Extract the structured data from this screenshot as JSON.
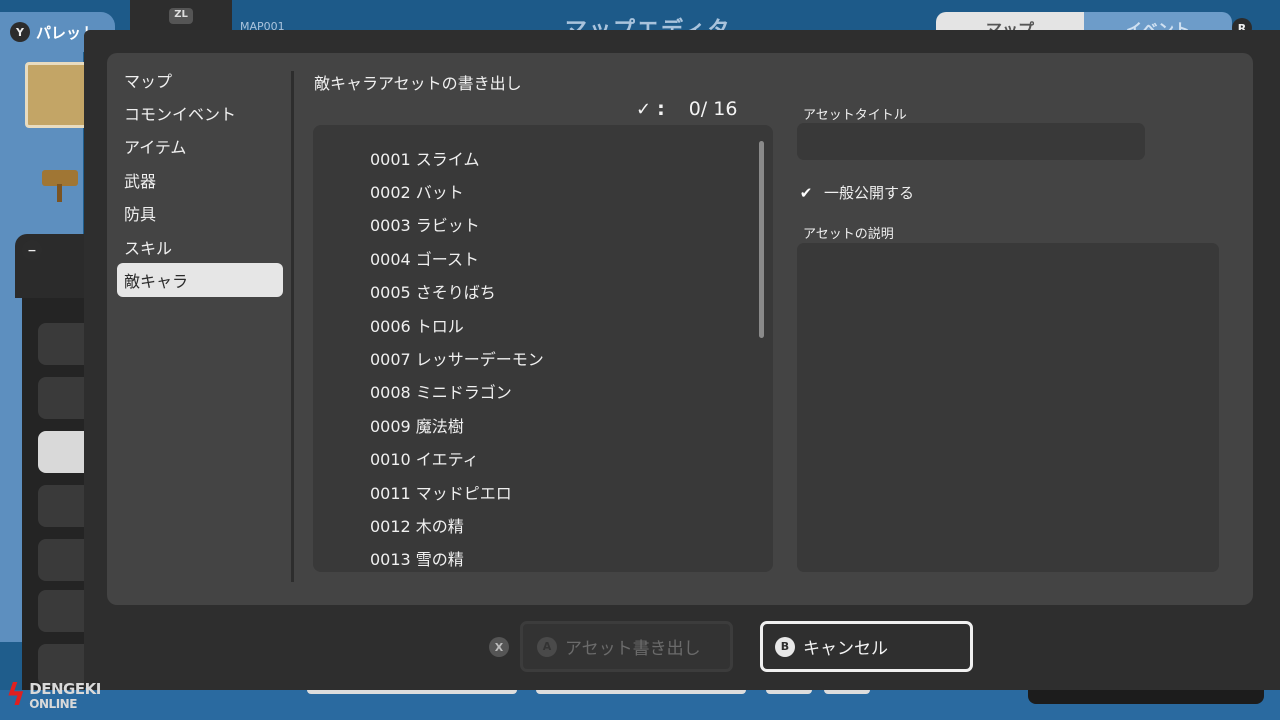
{
  "background": {
    "palette_tab": {
      "button": "Y",
      "label": "パレット"
    },
    "zl_button": "ZL",
    "map_id": "MAP001",
    "screen_title": "マップエディタ",
    "tabs": [
      "マップ",
      "イベント"
    ],
    "r_button": "R",
    "minus_button": "−"
  },
  "dialog": {
    "categories": [
      {
        "label": "マップ"
      },
      {
        "label": "コモンイベント"
      },
      {
        "label": "アイテム"
      },
      {
        "label": "武器"
      },
      {
        "label": "防具"
      },
      {
        "label": "スキル"
      },
      {
        "label": "敵キャラ",
        "selected": true
      }
    ],
    "section_title": "敵キャラアセットの書き出し",
    "selection_count": {
      "check": "✓",
      "colon": ":",
      "text": "0/ 16"
    },
    "enemies": [
      "0001 スライム",
      "0002 バット",
      "0003 ラビット",
      "0004 ゴースト",
      "0005 さそりばち",
      "0006 トロル",
      "0007 レッサーデーモン",
      "0008 ミニドラゴン",
      "0009 魔法樹",
      "0010 イエティ",
      "0011 マッドピエロ",
      "0012 木の精",
      "0013 雪の精"
    ],
    "asset_title_label": "アセットタイトル",
    "asset_title_value": "",
    "public_checkbox": {
      "label": "一般公開する",
      "checked": true
    },
    "description_label": "アセットの説明",
    "description_value": ""
  },
  "footer": {
    "x_button": "X",
    "export_button": {
      "glyph": "A",
      "label": "アセット書き出し",
      "enabled": false
    },
    "cancel_button": {
      "glyph": "B",
      "label": "キャンセル"
    }
  },
  "watermark": {
    "line1": "DENGEKI",
    "line2": "ONLINE"
  },
  "colors": {
    "background_blue": "#1f5d8c",
    "dialog": "#2e2e2e",
    "panel": "#444444",
    "field": "#393939",
    "selected_item": "#e6e6e6"
  }
}
